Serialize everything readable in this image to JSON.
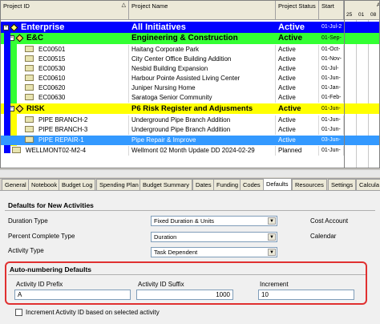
{
  "columns": {
    "project_id": "Project ID",
    "project_name": "Project Name",
    "project_status": "Project Status",
    "start": "Start",
    "gantt_day1": "25",
    "gantt_day2": "01",
    "gantt_day3": "08",
    "gantt_top": "A"
  },
  "rows": [
    {
      "id": "Enterprise",
      "name": "All  Initiatives",
      "status": "Active",
      "start": "01-Jul-2"
    },
    {
      "id": "E&C",
      "name": "Engineering & Construction",
      "status": "Active",
      "start": "01-Sep-"
    },
    {
      "id": "EC00501",
      "name": "Haitang Corporate Park",
      "status": "Active",
      "start": "01-Oct-"
    },
    {
      "id": "EC00515",
      "name": "City Center Office Building Addition",
      "status": "Active",
      "start": "01-Nov-"
    },
    {
      "id": "EC00530",
      "name": "Nesbid Building Expansion",
      "status": "Active",
      "start": "01-Jul-"
    },
    {
      "id": "EC00610",
      "name": "Harbour Pointe Assisted Living Center",
      "status": "Active",
      "start": "01-Jun-"
    },
    {
      "id": "EC00620",
      "name": "Juniper Nursing Home",
      "status": "Active",
      "start": "01-Jan-"
    },
    {
      "id": "EC00630",
      "name": "Saratoga Senior Community",
      "status": "Active",
      "start": "01-Feb-"
    },
    {
      "id": "RISK",
      "name": "P6 Risk Register and Adjusments",
      "status": "Active",
      "start": "01-Jun-"
    },
    {
      "id": "PIPE BRANCH-2",
      "name": "Underground Pipe Branch Addition",
      "status": "Active",
      "start": "01-Jun-"
    },
    {
      "id": "PIPE BRANCH-3",
      "name": "Underground Pipe Branch Addition",
      "status": "Active",
      "start": "01-Jun-"
    },
    {
      "id": "PIPE REPAIR-1",
      "name": "Pipe Repair & Improve",
      "status": "Active",
      "start": "03-Jun-"
    },
    {
      "id": "WELLMONT02-M2-4",
      "name": "Wellmont 02 Month Update DD 2024-02-29",
      "status": "Planned",
      "start": "01-Jun-"
    }
  ],
  "tabs": [
    "General",
    "Notebook",
    "Budget Log",
    "Spending Plan",
    "Budget Summary",
    "Dates",
    "Funding",
    "Codes",
    "Defaults",
    "Resources",
    "Settings",
    "Calcula"
  ],
  "active_tab": "Defaults",
  "defaults": {
    "section_title": "Defaults for New Activities",
    "duration_type_label": "Duration Type",
    "duration_type_value": "Fixed Duration & Units",
    "percent_complete_label": "Percent Complete Type",
    "percent_complete_value": "Duration",
    "activity_type_label": "Activity Type",
    "activity_type_value": "Task Dependent",
    "cost_account_label": "Cost Account",
    "calendar_label": "Calendar"
  },
  "autonum": {
    "section_title": "Auto-numbering Defaults",
    "prefix_label": "Activity ID Prefix",
    "prefix_value": "A",
    "suffix_label": "Activity ID Suffix",
    "suffix_value": "1000",
    "increment_label": "Increment",
    "increment_value": "10",
    "checkbox_label": "Increment Activity ID based on selected activity"
  },
  "colors": {
    "enterprise_row": "#0000ff",
    "ec_row": "#33ff33",
    "risk_row": "#ffff00",
    "selected_row": "#3399ff",
    "highlight_border": "#e03030"
  }
}
